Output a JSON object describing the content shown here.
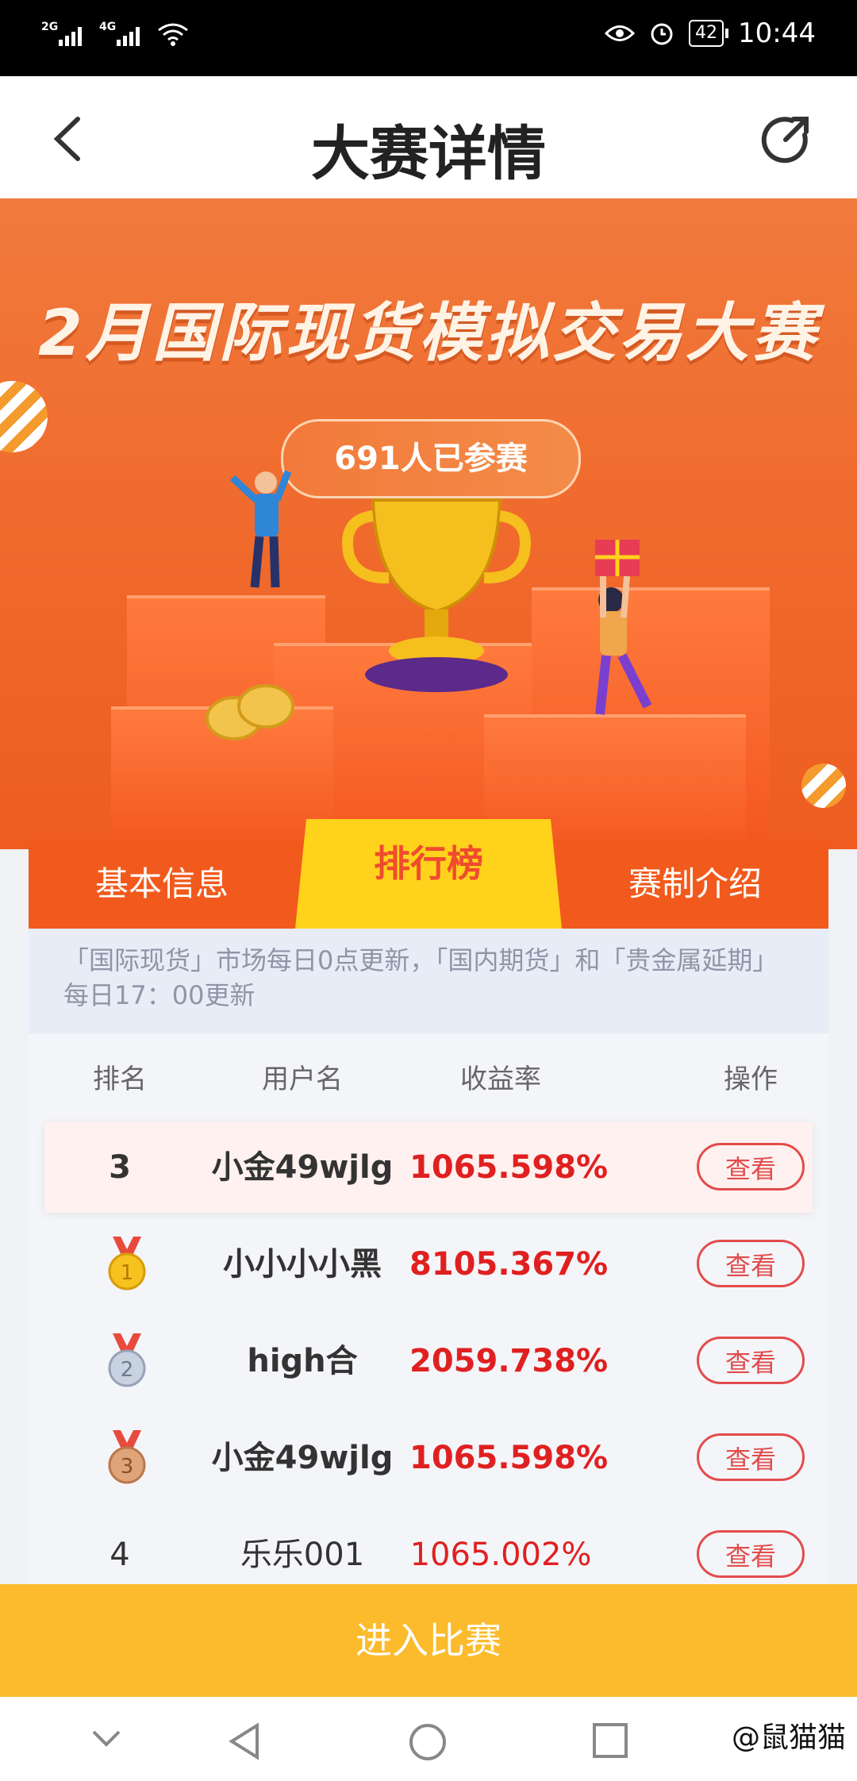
{
  "status_bar": {
    "signal1_label": "2G",
    "signal2_label": "4G",
    "battery": "42",
    "time": "10:44"
  },
  "nav": {
    "title": "大赛详情"
  },
  "hero": {
    "title": "2月国际现货模拟交易大赛",
    "participants": "691人已参赛"
  },
  "tabs": [
    {
      "label": "基本信息"
    },
    {
      "label": "排行榜"
    },
    {
      "label": "赛制介绍"
    }
  ],
  "notice": "「国际现货」市场每日0点更新，「国内期货」和「贵金属延期」每日17：00更新",
  "table": {
    "headers": [
      "排名",
      "用户名",
      "收益率",
      "操作"
    ],
    "rows": [
      {
        "rank": "3",
        "user": "小金49wjlg",
        "yield": "1065.598%",
        "action": "查看"
      },
      {
        "rank": "1",
        "user": "小小小小黑",
        "yield": "8105.367%",
        "action": "查看"
      },
      {
        "rank": "2",
        "user": "high合",
        "yield": "2059.738%",
        "action": "查看"
      },
      {
        "rank": "3",
        "user": "小金49wjlg",
        "yield": "1065.598%",
        "action": "查看"
      },
      {
        "rank": "4",
        "user": "乐乐001",
        "yield": "1065.002%",
        "action": "查看"
      }
    ]
  },
  "enter_button": "进入比赛",
  "watermark": "@鼠猫猫",
  "colors": {
    "accent": "#f15a1c",
    "tab_active": "#ffd21c",
    "yield": "#e02020",
    "enter": "#fbbb2c"
  }
}
